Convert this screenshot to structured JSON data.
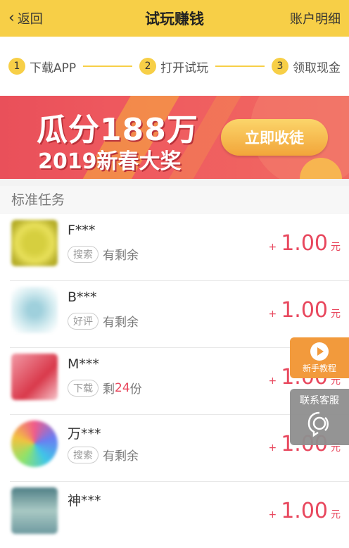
{
  "header": {
    "back_label": "返回",
    "title": "试玩赚钱",
    "account_label": "账户明细"
  },
  "steps": [
    {
      "num": "1",
      "label": "下载APP"
    },
    {
      "num": "2",
      "label": "打开试玩"
    },
    {
      "num": "3",
      "label": "领取现金"
    }
  ],
  "banner": {
    "line1": "瓜分188万",
    "line2": "2019新春大奖",
    "button": "立即收徒"
  },
  "section_title": "标准任务",
  "tasks": [
    {
      "name": "F***",
      "tag": "搜索",
      "status": "有剩余",
      "plus": "+",
      "amount": "1.00",
      "unit": "元",
      "thumb_color": "#e8e05a"
    },
    {
      "name": "B***",
      "tag": "好评",
      "status": "有剩余",
      "plus": "+",
      "amount": "1.00",
      "unit": "元",
      "thumb_color": "#bfe3ea"
    },
    {
      "name": "M***",
      "tag": "下载",
      "status_prefix": "剩",
      "status_count": "24",
      "status_suffix": "份",
      "plus": "+",
      "amount": "1.00",
      "unit": "元",
      "thumb_color": "#e86a78"
    },
    {
      "name": "万***",
      "tag": "搜索",
      "status": "有剩余",
      "plus": "+",
      "amount": "1.00",
      "unit": "元",
      "thumb_color": "#6aa0e8"
    },
    {
      "name": "神***",
      "tag": "",
      "status": "",
      "plus": "+",
      "amount": "1.00",
      "unit": "元",
      "thumb_color": "#6f9aa0"
    }
  ],
  "float": {
    "tutorial_label": "新手教程",
    "service_label": "联系客服"
  }
}
